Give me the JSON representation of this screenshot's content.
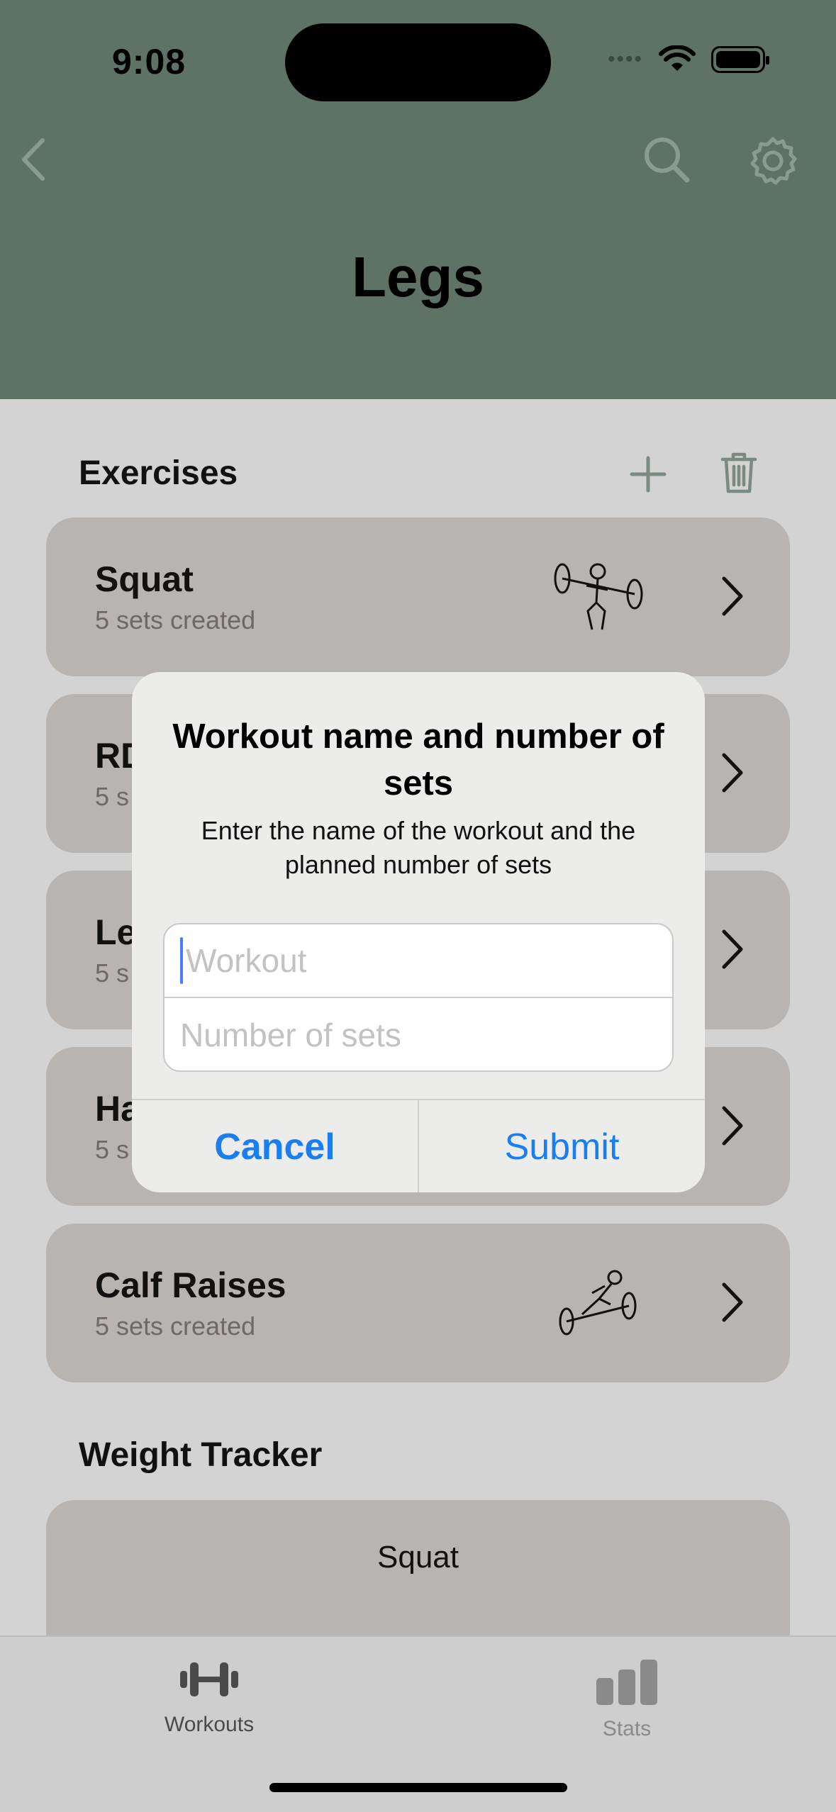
{
  "status_bar": {
    "time": "9:08",
    "signal": "••••"
  },
  "header": {
    "title": "Legs"
  },
  "exercises": {
    "section_title": "Exercises",
    "items": [
      {
        "name": "Squat",
        "subtitle": "5 sets created"
      },
      {
        "name": "RD",
        "subtitle": "5 s"
      },
      {
        "name": "Le",
        "subtitle": "5 s"
      },
      {
        "name": "Ha",
        "subtitle": "5 s"
      },
      {
        "name": "Calf Raises",
        "subtitle": "5 sets created"
      }
    ]
  },
  "weight_tracker": {
    "section_title": "Weight Tracker",
    "card_label": "Squat"
  },
  "alert": {
    "title": "Workout name and number of sets",
    "message": "Enter the name of the workout and the planned number of sets",
    "workout_placeholder": "Workout",
    "sets_placeholder": "Number of sets",
    "cancel_label": "Cancel",
    "submit_label": "Submit"
  },
  "tabbar": {
    "workouts_label": "Workouts",
    "stats_label": "Stats"
  },
  "colors": {
    "header": "#5e7366",
    "card": "#b8b4b2",
    "accent": "#1a7df0"
  }
}
